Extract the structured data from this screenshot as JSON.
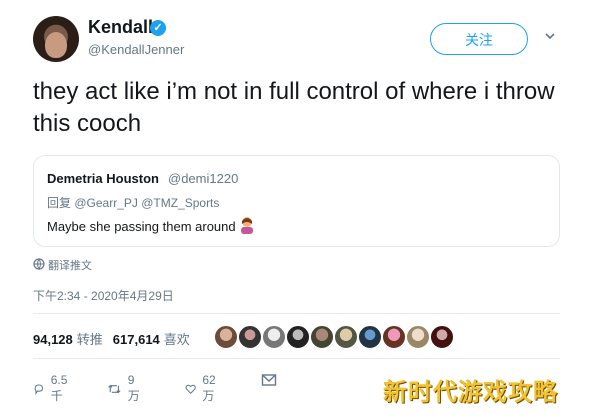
{
  "author": {
    "name": "Kendall",
    "handle": "@KendallJenner",
    "verified_mark": "✓"
  },
  "follow_label": "关注",
  "tweet_text": "they act like i’m not in full control of where i throw this cooch",
  "quoted": {
    "name": "Demetria Houston",
    "handle": "@demi1220",
    "reply_to": "回复 @Gearr_PJ @TMZ_Sports",
    "text": "Maybe she passing them around"
  },
  "translate_label": "翻译推文",
  "timestamp": "下午2:34 - 2020年4月29日",
  "stats": {
    "retweets_count": "94,128",
    "retweets_label": "转推",
    "likes_count": "617,614",
    "likes_label": "喜欢"
  },
  "actions": {
    "replies": "6.5千",
    "retweets": "9万",
    "likes": "62万"
  },
  "watermark": "新时代游戏攻略",
  "colors": {
    "accent": "#1da1f2",
    "secondary_text": "#657786",
    "watermark": "#f2c230"
  }
}
